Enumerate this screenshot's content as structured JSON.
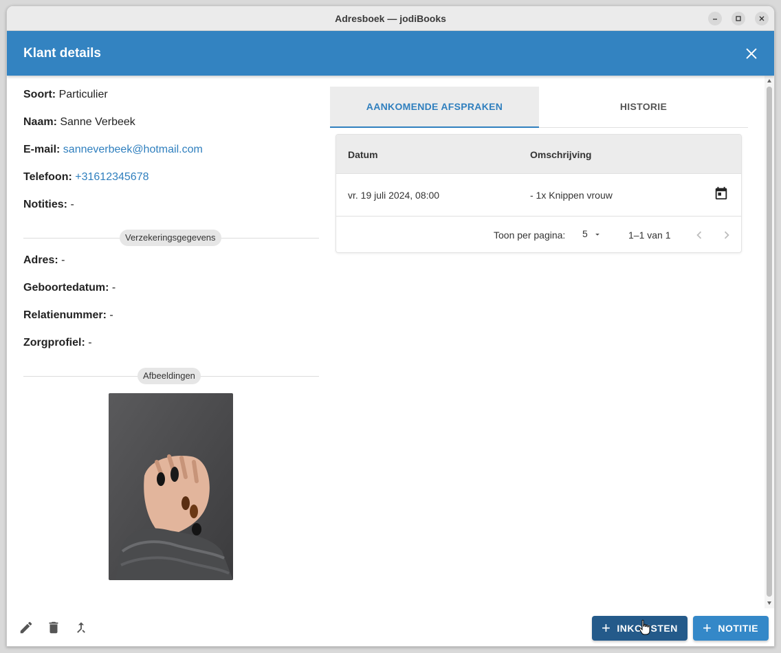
{
  "window": {
    "title": "Adresboek — jodiBooks"
  },
  "dialog": {
    "title": "Klant details"
  },
  "client": {
    "soort_label": "Soort:",
    "soort": "Particulier",
    "naam_label": "Naam:",
    "naam": "Sanne Verbeek",
    "email_label": "E-mail:",
    "email": "sanneverbeek@hotmail.com",
    "telefoon_label": "Telefoon:",
    "telefoon": "+31612345678",
    "notities_label": "Notities:",
    "notities": "-"
  },
  "insurance": {
    "heading": "Verzekeringsgegevens",
    "adres_label": "Adres:",
    "adres": "-",
    "geboortedatum_label": "Geboortedatum:",
    "geboortedatum": "-",
    "relatienummer_label": "Relatienummer:",
    "relatienummer": "-",
    "zorgprofiel_label": "Zorgprofiel:",
    "zorgprofiel": "-"
  },
  "images": {
    "heading": "Afbeeldingen"
  },
  "tabs": [
    {
      "label": "AANKOMENDE AFSPRAKEN",
      "active": true
    },
    {
      "label": "HISTORIE",
      "active": false
    }
  ],
  "table": {
    "columns": [
      "Datum",
      "Omschrijving"
    ],
    "rows": [
      {
        "datum": "vr. 19 juli 2024, 08:00",
        "omschrijving": "- 1x Knippen vrouw"
      }
    ],
    "rows_per_page_label": "Toon per pagina:",
    "rows_per_page": "5",
    "range": "1–1 van 1"
  },
  "footer": {
    "inkomsten_label": "INKOMSTEN",
    "notitie_label": "NOTITIE"
  },
  "colors": {
    "header": "#3383c1",
    "accent": "#2f7fbe",
    "button_dark": "#245a8a",
    "button_blue": "#3488c8"
  },
  "icons": [
    "minimize-icon",
    "maximize-icon",
    "close-window-icon",
    "close-icon",
    "calendar-icon",
    "chevron-left-icon",
    "chevron-right-icon",
    "edit-icon",
    "delete-icon",
    "merge-icon",
    "plus-icon"
  ]
}
